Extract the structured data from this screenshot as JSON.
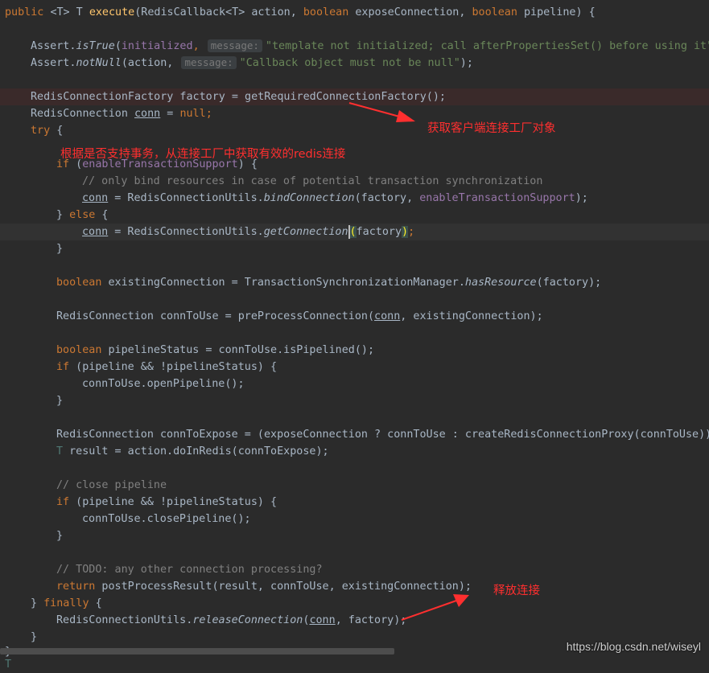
{
  "code": {
    "l1": {
      "kw_public": "public",
      "generic": "<T> T ",
      "method": "execute",
      "sig_rest": "(RedisCallback<T> action, ",
      "kw_bool1": "boolean",
      "p1": " exposeConnection, ",
      "kw_bool2": "boolean",
      "p2": " pipeline) {"
    },
    "l2": {
      "obj": "Assert.",
      "method": "isTrue",
      "open": "(",
      "field": "initialized",
      "comma": ",",
      "hint": "message:",
      "str": "\"template not initialized; call afterPropertiesSet() before using it\""
    },
    "l3": {
      "obj": "Assert.",
      "method": "notNull",
      "open": "(action,",
      "hint": "message:",
      "str": "\"Callback object must not be null\"",
      "close": ");"
    },
    "l4": {
      "text": "RedisConnectionFactory factory = getRequiredConnectionFactory();"
    },
    "l5": {
      "a": "RedisConnection ",
      "var": "conn",
      "b": " = ",
      "kw_null": "null",
      "c": ";"
    },
    "l6": {
      "kw_try": "try",
      "b": " {"
    },
    "l7": {
      "kw_if": "if",
      "a": " (",
      "field": "enableTransactionSupport",
      "b": ") {"
    },
    "l8": {
      "comment": "// only bind resources in case of potential transaction synchronization"
    },
    "l9": {
      "var": "conn",
      "a": " = RedisConnectionUtils.",
      "method": "bindConnection",
      "b": "(factory, ",
      "field": "enableTransactionSupport",
      "c": ");"
    },
    "l10": {
      "a": "} ",
      "kw_else": "else",
      "b": " {"
    },
    "l11": {
      "var": "conn",
      "a": " = RedisConnectionUtils.",
      "method": "getConnection",
      "paren": "(",
      "b": "factory",
      "paren_close": ")",
      "c": ";"
    },
    "l12": {
      "text": "}"
    },
    "l13": {
      "kw_bool": "boolean",
      "a": " existingConnection = TransactionSynchronizationManager.",
      "method": "hasResource",
      "b": "(factory);"
    },
    "l14": {
      "a": "RedisConnection connToUse = preProcessConnection(",
      "var": "conn",
      "b": ", existingConnection);"
    },
    "l15": {
      "kw_bool": "boolean",
      "a": " pipelineStatus = connToUse.isPipelined();"
    },
    "l16": {
      "kw_if": "if",
      "a": " (pipeline && !pipelineStatus) {"
    },
    "l17": {
      "text": "connToUse.openPipeline();"
    },
    "l18": {
      "text": "}"
    },
    "l19": {
      "text": "RedisConnection connToExpose = (exposeConnection ? connToUse : createRedisConnectionProxy(connToUse));"
    },
    "l20": {
      "tp": "T",
      "a": " result = action.doInRedis(connToExpose);"
    },
    "l21": {
      "comment": "// close pipeline"
    },
    "l22": {
      "kw_if": "if",
      "a": " (pipeline && !pipelineStatus) {"
    },
    "l23": {
      "text": "connToUse.closePipeline();"
    },
    "l24": {
      "text": "}"
    },
    "l25": {
      "comment": "// TODO: any other connection processing?"
    },
    "l26": {
      "kw_return": "return",
      "a": " postProcessResult(result, connToUse, existingConnection);"
    },
    "l27": {
      "a": "} ",
      "kw_finally": "finally",
      "b": " {"
    },
    "l28": {
      "a": "RedisConnectionUtils.",
      "method": "releaseConnection",
      "b": "(",
      "var": "conn",
      "c": ", factory);"
    },
    "l29": {
      "text": "}"
    },
    "l30": {
      "text": "}"
    },
    "l31": {
      "text": "T"
    }
  },
  "annotations": {
    "factory_note": "获取客户端连接工厂对象",
    "connection_note": "根据是否支持事务，从连接工厂中获取有效的redis连接",
    "release_note": "释放连接",
    "color": "#ff2f2f"
  },
  "watermark": "https://blog.csdn.net/wiseyl",
  "theme": {
    "background": "#2b2b2b",
    "keyword": "#cc7832",
    "method": "#ffc66d",
    "field": "#9876aa",
    "string": "#6a8759",
    "comment": "#808080"
  }
}
